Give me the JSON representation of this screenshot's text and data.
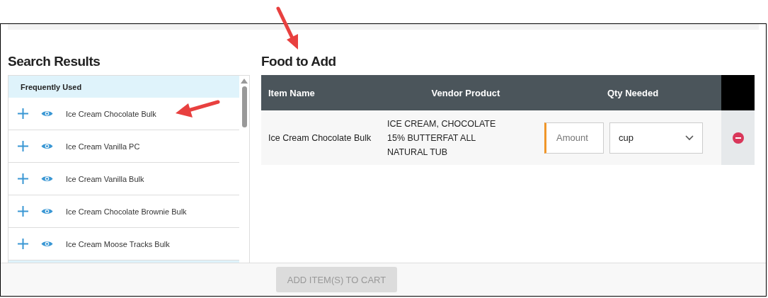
{
  "search_results": {
    "title": "Search Results",
    "group": "Frequently Used",
    "items": [
      {
        "name": "Ice Cream Chocolate Bulk"
      },
      {
        "name": "Ice Cream Vanilla PC"
      },
      {
        "name": "Ice Cream Vanilla Bulk"
      },
      {
        "name": "Ice Cream Chocolate Brownie Bulk"
      },
      {
        "name": "Ice Cream Moose Tracks Bulk"
      }
    ]
  },
  "food_to_add": {
    "title": "Food to Add",
    "columns": [
      "Item Name",
      "Vendor Product",
      "Qty Needed"
    ],
    "rows": [
      {
        "item_name": "Ice Cream Chocolate Bulk",
        "vendor_product": "ICE CREAM, CHOCOLATE 15% BUTTERFAT ALL NATURAL TUB",
        "amount_placeholder": "Amount",
        "unit": "cup"
      }
    ]
  },
  "add_button": {
    "label": "ADD ITEM(S) TO CART",
    "disabled": true
  }
}
